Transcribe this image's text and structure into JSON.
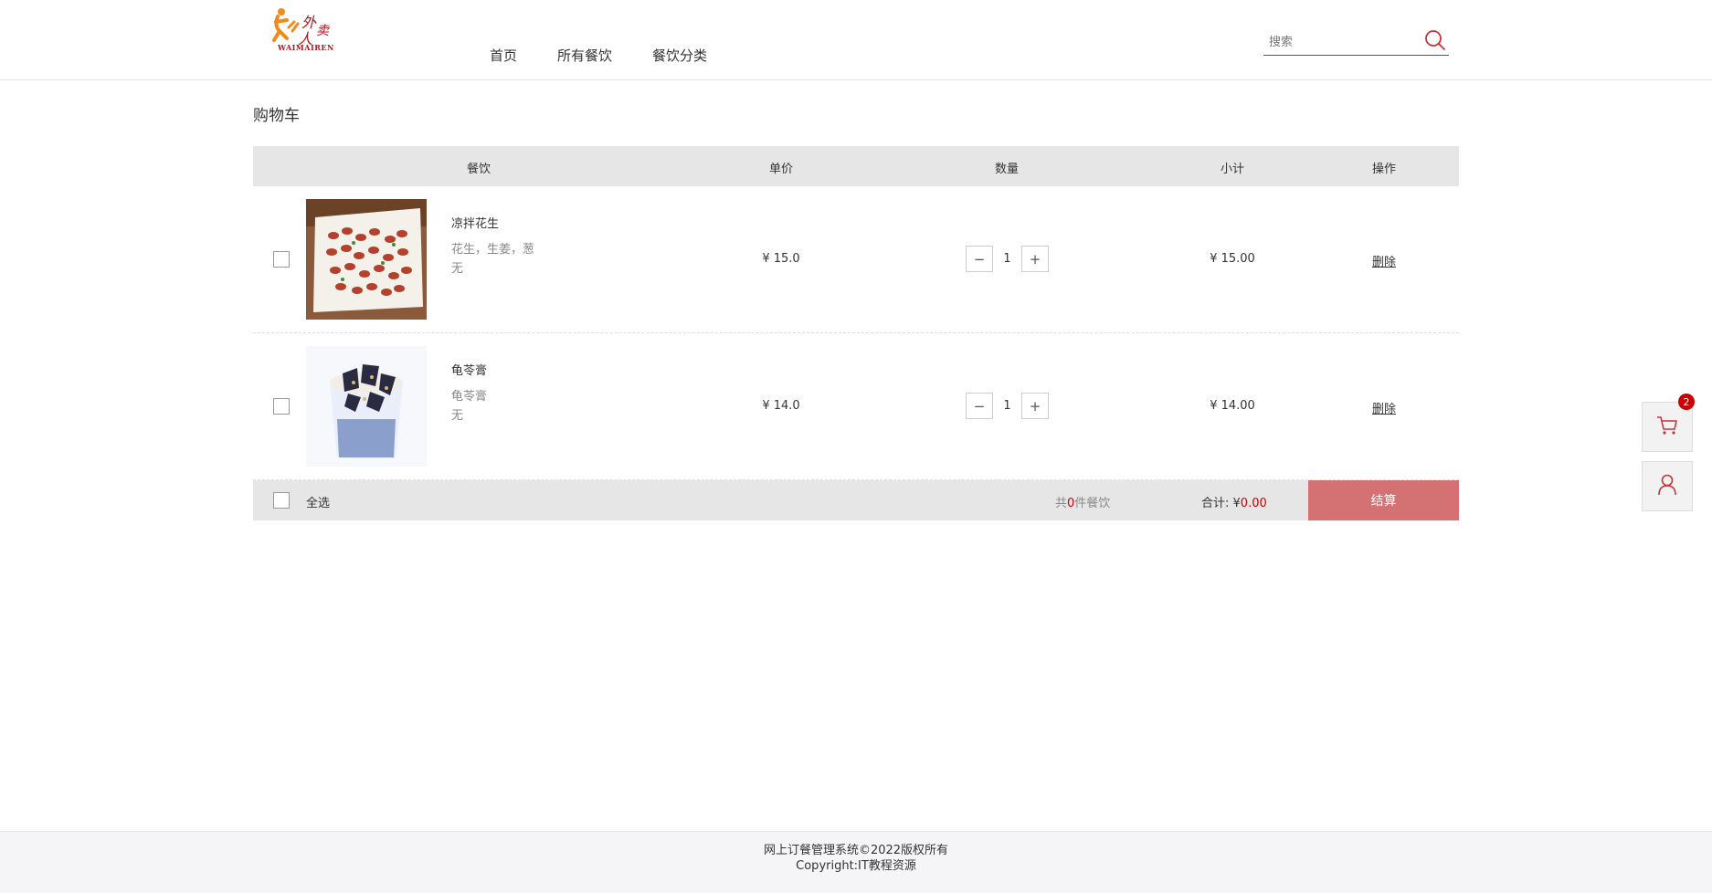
{
  "header": {
    "logo_alt": "外卖人",
    "logo_text": "WAIMAIREN",
    "nav": [
      {
        "label": "首页"
      },
      {
        "label": "所有餐饮"
      },
      {
        "label": "餐饮分类"
      }
    ],
    "search": {
      "placeholder": "搜索",
      "value": ""
    }
  },
  "page_title": "购物车",
  "table": {
    "headers": {
      "food": "餐饮",
      "price": "单价",
      "quantity": "数量",
      "subtotal": "小计",
      "action": "操作"
    },
    "rows": [
      {
        "name": "凉拌花生",
        "desc_line1": "花生，生姜，葱",
        "desc_line2": "无",
        "price": "¥ 15.0",
        "quantity": "1",
        "subtotal": "¥ 15.00",
        "delete_label": "删除",
        "checked": false
      },
      {
        "name": "龟苓膏",
        "desc_line1": "龟苓膏",
        "desc_line2": "无",
        "price": "¥ 14.0",
        "quantity": "1",
        "subtotal": "¥ 14.00",
        "delete_label": "删除",
        "checked": false
      }
    ],
    "qty_minus": "−",
    "qty_plus": "+"
  },
  "footer_bar": {
    "select_all": "全选",
    "count_prefix": "共",
    "count_value": "0",
    "count_suffix": "件餐饮",
    "total_label": "合计: ",
    "total_currency": "¥",
    "total_amount": "0.00",
    "checkout_label": "结算"
  },
  "side": {
    "cart_badge": "2"
  },
  "footer": {
    "line1": "网上订餐管理系统©2022版权所有",
    "line2": "Copyright:IT教程资源"
  },
  "colors": {
    "accent": "#d47173",
    "price_red": "#cc0000"
  }
}
